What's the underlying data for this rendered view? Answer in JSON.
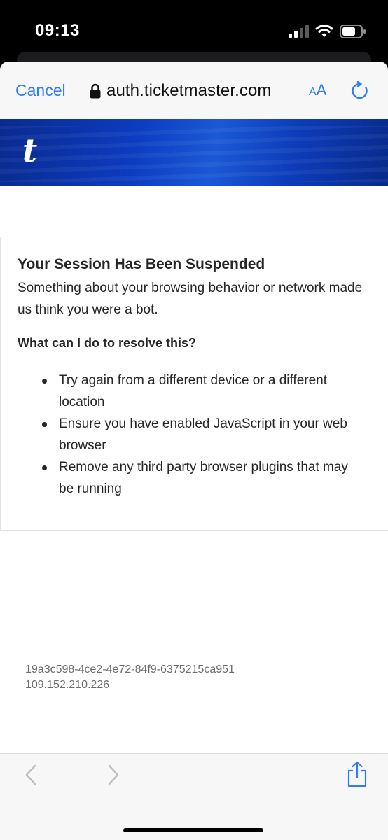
{
  "status_bar": {
    "time": "09:13",
    "icons": [
      "signal-icon",
      "wifi-icon",
      "battery-icon"
    ]
  },
  "nav": {
    "cancel_label": "Cancel",
    "url": "auth.ticketmaster.com",
    "aa_small": "A",
    "aa_large": "A",
    "lock_icon": "lock-icon",
    "reload_icon": "reload-icon"
  },
  "brand": {
    "logo_text": "t"
  },
  "notice": {
    "title": "Your Session Has Been Suspended",
    "description": "Something about your browsing behavior or network made us think you were a bot.",
    "resolve_heading": "What can I do to resolve this?",
    "bullets": [
      "Try again from a different device or a different location",
      "Ensure you have enabled JavaScript in your web browser",
      "Remove any third party browser plugins that may be running"
    ]
  },
  "meta": {
    "session_id": "19a3c598-4ce2-4e72-84f9-6375215ca951",
    "ip_address": "109.152.210.226"
  },
  "toolbar": {
    "icons": [
      "back-icon",
      "forward-icon",
      "share-icon"
    ]
  },
  "colors": {
    "accent": "#2f7cf6",
    "brand_blue": "#0c3cc0",
    "text": "#262626",
    "muted": "#6c6c6c"
  }
}
